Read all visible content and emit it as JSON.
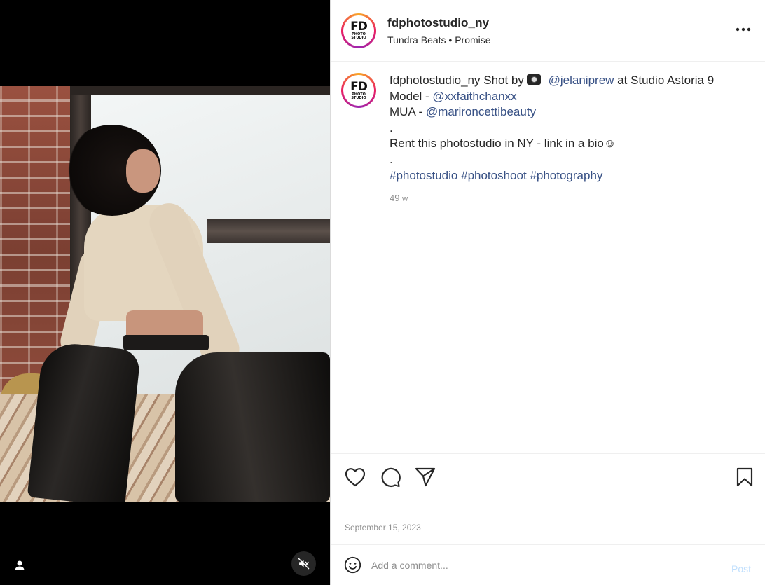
{
  "media": {
    "user_icon": "user-icon",
    "mute_icon": "volume-muted-icon"
  },
  "profile": {
    "logo_top": "FD",
    "logo_sub1": "PHOTO",
    "logo_sub2": "STUDIO"
  },
  "header": {
    "username": "fdphotostudio_ny",
    "audio_artist": "Tundra Beats",
    "separator": "•",
    "audio_track": "Promise",
    "more_icon": "more-horizontal-icon"
  },
  "caption": {
    "username": "fdphotostudio_ny",
    "line1_prefix": "Shot by",
    "camera_icon": "camera-emoji-icon",
    "photographer": "@jelaniprew",
    "line1_suffix": "at Studio Astoria 9",
    "model_label": "Model -",
    "model": "@xxfaithchanxx",
    "mua_label": "MUA -",
    "mua": "@marironcettibeauty",
    "dot1": ".",
    "rent": "Rent this photostudio in NY - link in a bio☺",
    "dot2": ".",
    "tag1": "#photostudio",
    "tag2": "#photoshoot",
    "tag3": "#photography",
    "age_num": "49",
    "age_unit": "w"
  },
  "actions": {
    "like_icon": "heart-icon",
    "comment_icon": "comment-icon",
    "share_icon": "send-icon",
    "save_icon": "bookmark-icon",
    "date": "September 15, 2023"
  },
  "comment": {
    "emoji_icon": "emoji-icon",
    "placeholder": "Add a comment...",
    "post_label": "Post"
  },
  "colors": {
    "link": "#385185",
    "post_disabled": "#c0dffd",
    "muted_text": "#8e8e8e"
  }
}
